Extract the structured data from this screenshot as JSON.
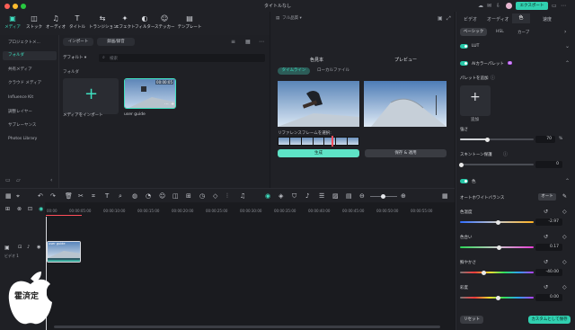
{
  "titlebar": {
    "title": "タイトルなし",
    "export": "エクスポート"
  },
  "toolbar": {
    "items": [
      {
        "label": "メディア",
        "glyph": "▣",
        "icon": "media-icon"
      },
      {
        "label": "ストック",
        "glyph": "◫",
        "icon": "stock-icon"
      },
      {
        "label": "オーディオ",
        "glyph": "♫",
        "icon": "audio-icon"
      },
      {
        "label": "タイトル",
        "glyph": "T",
        "icon": "title-icon"
      },
      {
        "label": "トランジション",
        "glyph": "⇆",
        "icon": "transition-icon"
      },
      {
        "label": "エフェクト",
        "glyph": "✦",
        "icon": "effect-icon"
      },
      {
        "label": "フィルター",
        "glyph": "◐",
        "icon": "filter-icon"
      },
      {
        "label": "ステッカー",
        "glyph": "☺",
        "icon": "sticker-icon"
      },
      {
        "label": "テンプレート",
        "glyph": "▤",
        "icon": "template-icon"
      }
    ]
  },
  "sidebar": {
    "items": [
      {
        "label": "プロジェクトメ..."
      },
      {
        "label": "フォルダ"
      },
      {
        "label": "共有メディア"
      },
      {
        "label": "クラウド メディア"
      },
      {
        "label": "Influence Kit"
      },
      {
        "label": "調整レイヤー"
      },
      {
        "label": "サブレーヤンス"
      },
      {
        "label": "Photos Library"
      }
    ]
  },
  "media": {
    "import_btn": "インポート",
    "record_btn": "録画/録音",
    "sort": "デフォルト",
    "search_placeholder": "検索",
    "folder_label": "フォルダ",
    "import_tile": "メディアをインポート",
    "clip_name": "user guide",
    "clip_time": "00:00:05"
  },
  "player": {
    "dropdown": "フル品質",
    "tab_left": "色見本",
    "tab_right": "プレビュー",
    "sub_timeline": "タイムライン",
    "sub_local": "ローカルファイル",
    "ref_label": "リファレンスフレームを選択:",
    "generate": "生成",
    "save_apply": "保存 & 適用"
  },
  "rpanel": {
    "tabs": [
      "ビデオ",
      "オーディオ",
      "色",
      "速度"
    ],
    "subtabs": [
      "ベーシック",
      "HSL",
      "カーブ"
    ],
    "lut": "LUT",
    "ai_palette": "AIカラーパレット",
    "ai_badge": "AI",
    "palette_add": "パレットを追加",
    "add": "追加",
    "strength_label": "強さ",
    "strength_value": "70",
    "strength_unit": "%",
    "skin_label": "スキントーン保護",
    "skin_value": "0",
    "color_label": "色",
    "wb_label": "オートホワイトバランス",
    "auto_btn": "オート",
    "temp_label": "色温度",
    "temp_value": "-2.97",
    "tint_label": "色合い",
    "tint_value": "0.17",
    "vib_label": "鮮やかさ",
    "vib_value": "-40.00",
    "sat_label": "彩度",
    "sat_value": "0.00",
    "reset": "リセット",
    "save_custom": "カスタムとして保存"
  },
  "timeline": {
    "ticks": [
      "00:00",
      "00:00:05:00",
      "00:00:10:00",
      "00:00:15:00",
      "00:00:20:00",
      "00:00:25:00",
      "00:00:30:00",
      "00:00:35:00",
      "00:00:40:00",
      "00:00:45:00",
      "00:00:50:00",
      "00:00:55:00"
    ],
    "track_label": "ビデオ 1",
    "clip_label": "user guide"
  },
  "watermark": {
    "text": "霍済定"
  }
}
